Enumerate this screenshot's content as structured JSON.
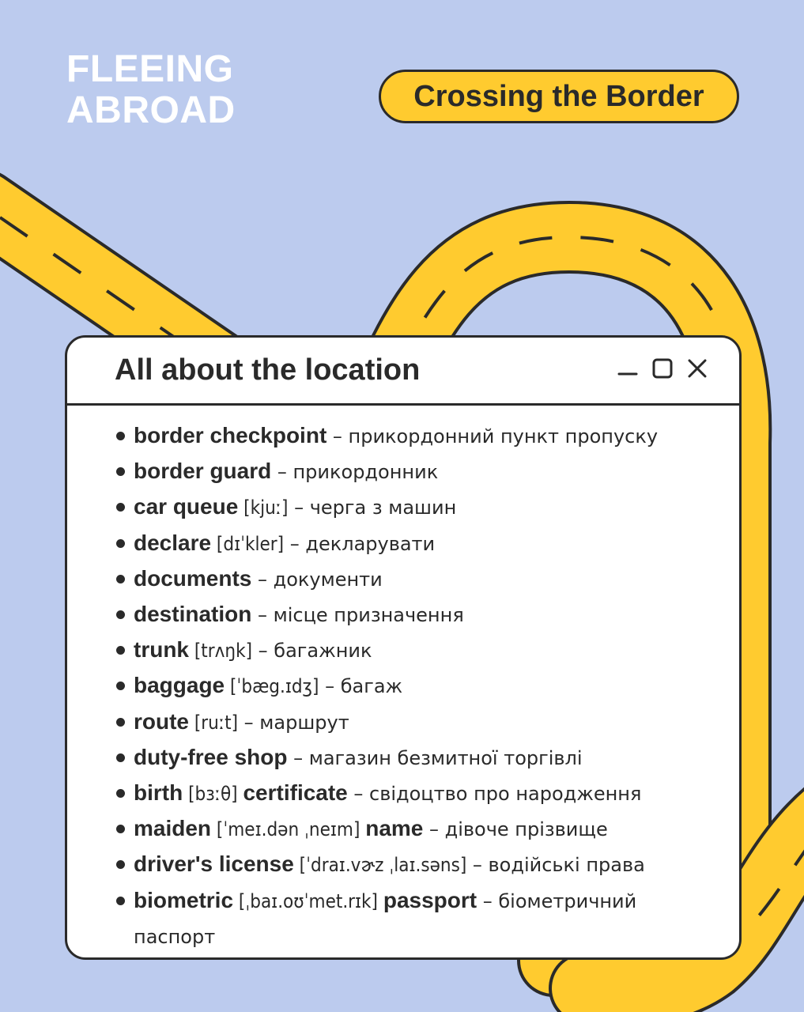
{
  "brand": {
    "line1": "FLEEING",
    "line2": "ABROAD"
  },
  "badge": {
    "label": "Crossing the Border"
  },
  "window": {
    "title": "All about the location"
  },
  "colors": {
    "background": "#BCCBEE",
    "road": "#FFCB2F",
    "outline": "#2A2A2A",
    "window": "#FFFFFF",
    "brand_text": "#FFFFFF"
  },
  "icons": [
    "minimize-icon",
    "maximize-icon",
    "close-icon"
  ],
  "vocabulary": [
    {
      "segments": [
        {
          "k": "t",
          "v": "border checkpoint"
        },
        {
          "k": "tr",
          "v": " – прикордонний пункт пропуску"
        }
      ]
    },
    {
      "segments": [
        {
          "k": "t",
          "v": "border guard"
        },
        {
          "k": "tr",
          "v": " – прикордонник"
        }
      ]
    },
    {
      "segments": [
        {
          "k": "t",
          "v": "car queue"
        },
        {
          "k": "p",
          "v": " [kjuː]"
        },
        {
          "k": "tr",
          "v": " – черга з машин"
        }
      ]
    },
    {
      "segments": [
        {
          "k": "t",
          "v": "declare"
        },
        {
          "k": "p",
          "v": " [dɪˈkler]"
        },
        {
          "k": "tr",
          "v": " – декларувати"
        }
      ]
    },
    {
      "segments": [
        {
          "k": "t",
          "v": "documents"
        },
        {
          "k": "tr",
          "v": " – документи"
        }
      ]
    },
    {
      "segments": [
        {
          "k": "t",
          "v": "destination"
        },
        {
          "k": "tr",
          "v": " – місце призначення"
        }
      ]
    },
    {
      "segments": [
        {
          "k": "t",
          "v": "trunk"
        },
        {
          "k": "p",
          "v": " [trʌŋk]"
        },
        {
          "k": "tr",
          "v": " – багажник"
        }
      ]
    },
    {
      "segments": [
        {
          "k": "t",
          "v": "baggage"
        },
        {
          "k": "p",
          "v": " [ˈbæg.ɪdʒ]"
        },
        {
          "k": "tr",
          "v": " – багаж"
        }
      ]
    },
    {
      "segments": [
        {
          "k": "t",
          "v": "route"
        },
        {
          "k": "p",
          "v": " [ruːt]"
        },
        {
          "k": "tr",
          "v": " – маршрут"
        }
      ]
    },
    {
      "segments": [
        {
          "k": "t",
          "v": "duty-free shop"
        },
        {
          "k": "tr",
          "v": " – магазин безмитної торгівлі"
        }
      ]
    },
    {
      "segments": [
        {
          "k": "t",
          "v": "birth"
        },
        {
          "k": "p",
          "v": " [bɜːθ] "
        },
        {
          "k": "t",
          "v": "certificate"
        },
        {
          "k": "tr",
          "v": " – свідоцтво про народження"
        }
      ]
    },
    {
      "segments": [
        {
          "k": "t",
          "v": "maiden"
        },
        {
          "k": "p",
          "v": " [ˈmeɪ.dən ˌneɪm] "
        },
        {
          "k": "t",
          "v": "name"
        },
        {
          "k": "tr",
          "v": " – дівоче прізвище"
        }
      ]
    },
    {
      "segments": [
        {
          "k": "t",
          "v": "driver's license"
        },
        {
          "k": "p",
          "v": " [ˈdraɪ.vɚz ˌlaɪ.səns]"
        },
        {
          "k": "tr",
          "v": " – водійські права"
        }
      ]
    },
    {
      "segments": [
        {
          "k": "t",
          "v": "biometric"
        },
        {
          "k": "p",
          "v": " [ˌbaɪ.oʊˈmet.rɪk] "
        },
        {
          "k": "t",
          "v": "passport"
        },
        {
          "k": "tr",
          "v": " – біометричний паспорт"
        }
      ]
    }
  ]
}
